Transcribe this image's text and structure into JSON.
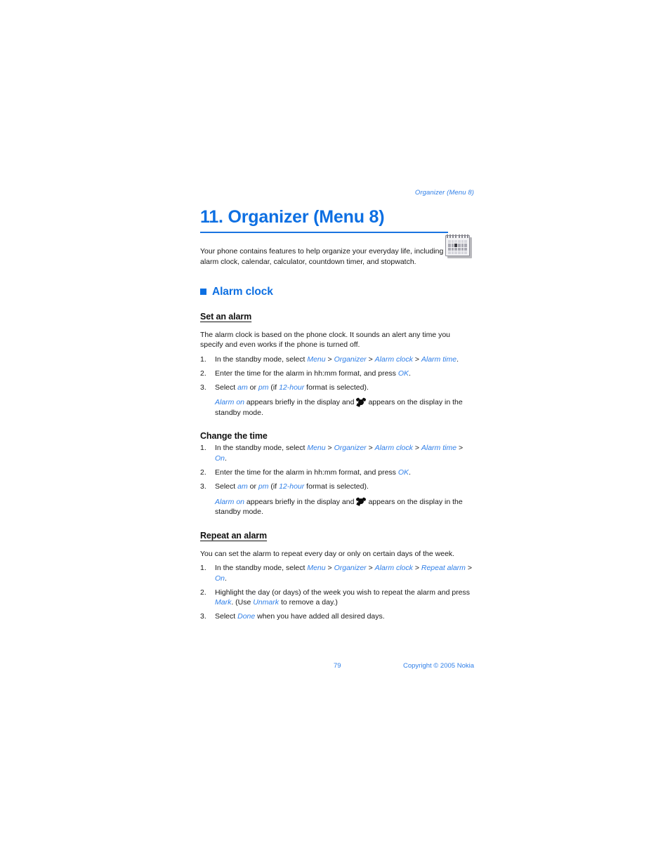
{
  "document": {
    "running_header": "Organizer (Menu 8)",
    "chapter_title": "11. Organizer (Menu 8)",
    "chapter_icon": "calendar-icon",
    "intro": "Your phone contains features to help organize your everyday life, including an alarm clock, calendar, calculator, countdown timer, and stopwatch."
  },
  "section": {
    "title": "Alarm clock",
    "bullet": "blue-square-bullet"
  },
  "set_an_alarm": {
    "heading": "Set an alarm",
    "intro": "The alarm clock is based on the phone clock. It sounds an alert any time you specify and even works if the phone is turned off.",
    "steps": [
      {
        "num": "1.",
        "lead": "In the standby mode, select ",
        "path": [
          "Menu",
          "Organizer",
          "Alarm clock",
          "Alarm time"
        ],
        "tail": "."
      },
      {
        "num": "2.",
        "lead": "Enter the time for the alarm in hh:mm format, and press ",
        "ui1": "OK",
        "tail": "."
      },
      {
        "num": "3.",
        "lead": "Select ",
        "ui1": "am",
        "mid1": " or ",
        "ui2": "pm",
        "mid2": " (if ",
        "ui3": "12-hour",
        "tail": " format is selected)."
      }
    ],
    "note": {
      "ui1": "Alarm on",
      "mid1": " appears briefly in the display and",
      "icon": "alarm-clock-icon",
      "tail": "appears on the display in the standby mode."
    }
  },
  "change_the_time": {
    "heading": "Change the time",
    "steps": [
      {
        "num": "1.",
        "lead": "In the standby mode, select ",
        "path": [
          "Menu",
          "Organizer",
          "Alarm clock",
          "Alarm time",
          "On"
        ],
        "tail": "."
      },
      {
        "num": "2.",
        "lead": "Enter the time for the alarm in hh:mm format, and press ",
        "ui1": "OK",
        "tail": "."
      },
      {
        "num": "3.",
        "lead": "Select ",
        "ui1": "am",
        "mid1": " or ",
        "ui2": "pm",
        "mid2": " (if ",
        "ui3": "12-hour",
        "tail": " format is selected)."
      }
    ],
    "note": {
      "ui1": "Alarm on",
      "mid1": " appears briefly in the display and",
      "icon": "alarm-clock-icon",
      "tail": "appears on the display in the standby mode."
    }
  },
  "repeat_an_alarm": {
    "heading": "Repeat an alarm",
    "intro": "You can set the alarm to repeat every day or only on certain days of the week.",
    "steps": [
      {
        "num": "1.",
        "lead": "In the standby mode, select ",
        "path": [
          "Menu",
          "Organizer",
          "Alarm clock",
          "Repeat alarm",
          "On"
        ],
        "tail": "."
      },
      {
        "num": "2.",
        "lead": "Highlight the day (or days) of the week you wish to repeat the alarm and press ",
        "ui1": "Mark",
        "mid1": ". (Use ",
        "ui2": "Unmark",
        "tail": " to remove a day.)"
      },
      {
        "num": "3.",
        "lead": "Select ",
        "ui1": "Done",
        "tail": " when you have added all desired days."
      }
    ]
  },
  "footer": {
    "page_number": "79",
    "copyright": "Copyright © 2005 Nokia"
  },
  "colors": {
    "accent_blue": "#0d6fe2",
    "link_blue": "#2f7fe8",
    "body_text": "#191919"
  }
}
